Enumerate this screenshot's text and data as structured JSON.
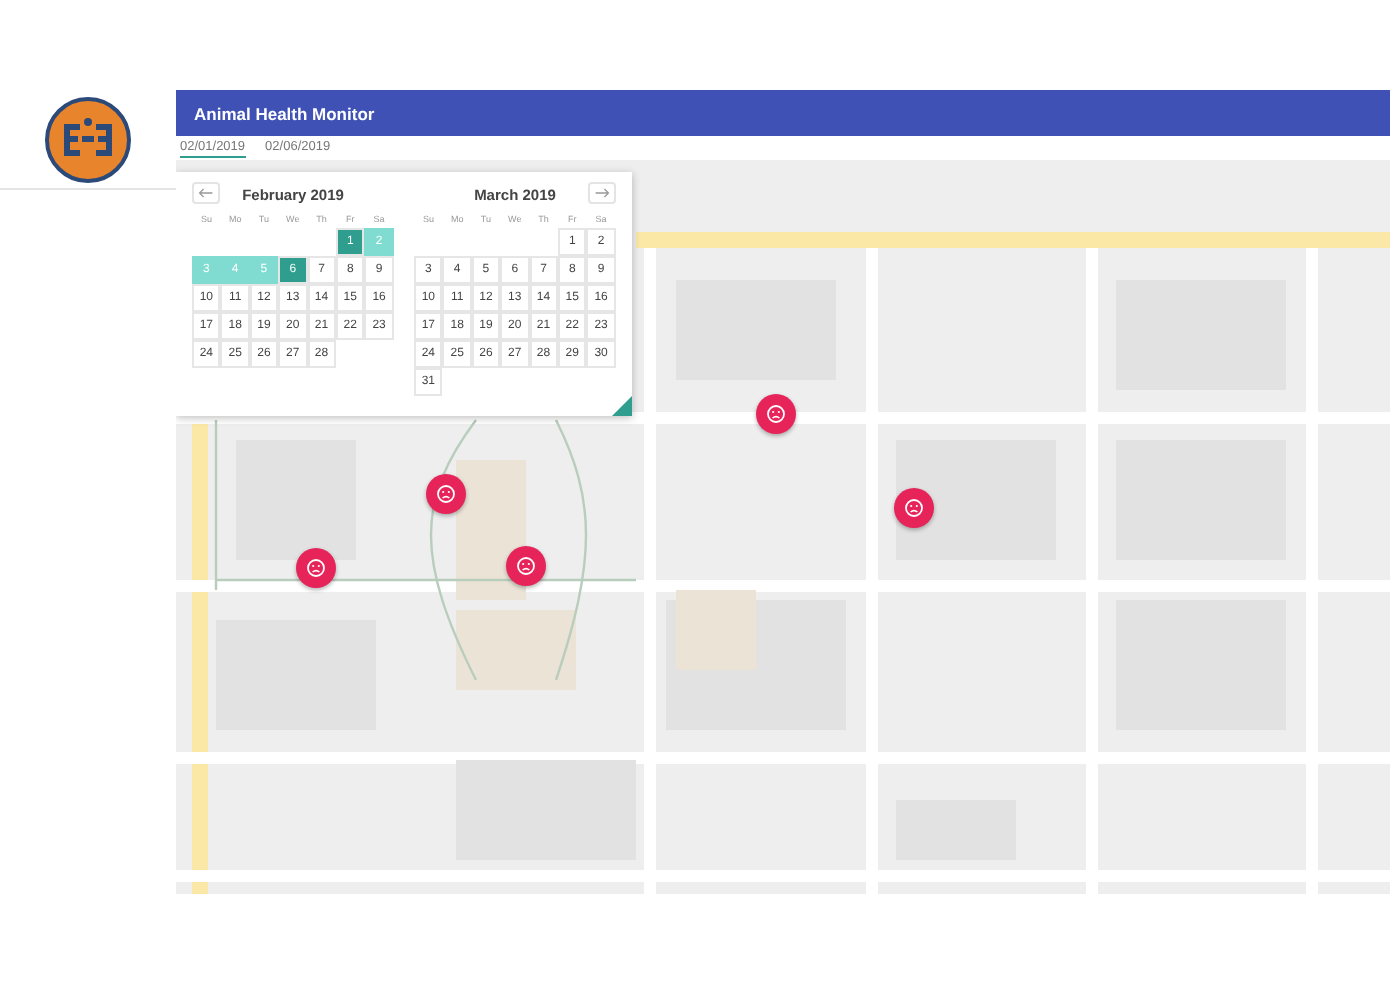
{
  "header": {
    "title": "Animal Health Monitor"
  },
  "date_range": {
    "start": "02/01/2019",
    "end": "02/06/2019"
  },
  "calendar": {
    "months": [
      {
        "title": "February 2019",
        "weekdays": [
          "Su",
          "Mo",
          "Tu",
          "We",
          "Th",
          "Fr",
          "Sa"
        ],
        "weeks": [
          [
            {
              "label": "1",
              "selected": true,
              "in_range": false
            },
            {
              "label": "2",
              "selected": false,
              "in_range": true
            }
          ],
          [
            {
              "label": "3",
              "selected": false,
              "in_range": true
            },
            {
              "label": "4",
              "selected": false,
              "in_range": true
            },
            {
              "label": "5",
              "selected": false,
              "in_range": true
            },
            {
              "label": "6",
              "selected": true,
              "in_range": false
            },
            {
              "label": "7",
              "selected": false,
              "in_range": false
            },
            {
              "label": "8",
              "selected": false,
              "in_range": false
            },
            {
              "label": "9",
              "selected": false,
              "in_range": false
            }
          ],
          [
            {
              "label": "10",
              "selected": false,
              "in_range": false
            },
            {
              "label": "11",
              "selected": false,
              "in_range": false
            },
            {
              "label": "12",
              "selected": false,
              "in_range": false
            },
            {
              "label": "13",
              "selected": false,
              "in_range": false
            },
            {
              "label": "14",
              "selected": false,
              "in_range": false
            },
            {
              "label": "15",
              "selected": false,
              "in_range": false
            },
            {
              "label": "16",
              "selected": false,
              "in_range": false
            }
          ],
          [
            {
              "label": "17",
              "selected": false,
              "in_range": false
            },
            {
              "label": "18",
              "selected": false,
              "in_range": false
            },
            {
              "label": "19",
              "selected": false,
              "in_range": false
            },
            {
              "label": "20",
              "selected": false,
              "in_range": false
            },
            {
              "label": "21",
              "selected": false,
              "in_range": false
            },
            {
              "label": "22",
              "selected": false,
              "in_range": false
            },
            {
              "label": "23",
              "selected": false,
              "in_range": false
            }
          ],
          [
            {
              "label": "24",
              "selected": false,
              "in_range": false
            },
            {
              "label": "25",
              "selected": false,
              "in_range": false
            },
            {
              "label": "26",
              "selected": false,
              "in_range": false
            },
            {
              "label": "27",
              "selected": false,
              "in_range": false
            },
            {
              "label": "28",
              "selected": false,
              "in_range": false
            }
          ]
        ]
      },
      {
        "title": "March 2019",
        "weekdays": [
          "Su",
          "Mo",
          "Tu",
          "We",
          "Th",
          "Fr",
          "Sa"
        ],
        "weeks": [
          [
            {
              "label": "1",
              "selected": false,
              "in_range": false
            },
            {
              "label": "2",
              "selected": false,
              "in_range": false
            }
          ],
          [
            {
              "label": "3",
              "selected": false,
              "in_range": false
            },
            {
              "label": "4",
              "selected": false,
              "in_range": false
            },
            {
              "label": "5",
              "selected": false,
              "in_range": false
            },
            {
              "label": "6",
              "selected": false,
              "in_range": false
            },
            {
              "label": "7",
              "selected": false,
              "in_range": false
            },
            {
              "label": "8",
              "selected": false,
              "in_range": false
            },
            {
              "label": "9",
              "selected": false,
              "in_range": false
            }
          ],
          [
            {
              "label": "10",
              "selected": false,
              "in_range": false
            },
            {
              "label": "11",
              "selected": false,
              "in_range": false
            },
            {
              "label": "12",
              "selected": false,
              "in_range": false
            },
            {
              "label": "13",
              "selected": false,
              "in_range": false
            },
            {
              "label": "14",
              "selected": false,
              "in_range": false
            },
            {
              "label": "15",
              "selected": false,
              "in_range": false
            },
            {
              "label": "16",
              "selected": false,
              "in_range": false
            }
          ],
          [
            {
              "label": "17",
              "selected": false,
              "in_range": false
            },
            {
              "label": "18",
              "selected": false,
              "in_range": false
            },
            {
              "label": "19",
              "selected": false,
              "in_range": false
            },
            {
              "label": "20",
              "selected": false,
              "in_range": false
            },
            {
              "label": "21",
              "selected": false,
              "in_range": false
            },
            {
              "label": "22",
              "selected": false,
              "in_range": false
            },
            {
              "label": "23",
              "selected": false,
              "in_range": false
            }
          ],
          [
            {
              "label": "24",
              "selected": false,
              "in_range": false
            },
            {
              "label": "25",
              "selected": false,
              "in_range": false
            },
            {
              "label": "26",
              "selected": false,
              "in_range": false
            },
            {
              "label": "27",
              "selected": false,
              "in_range": false
            },
            {
              "label": "28",
              "selected": false,
              "in_range": false
            },
            {
              "label": "29",
              "selected": false,
              "in_range": false
            },
            {
              "label": "30",
              "selected": false,
              "in_range": false
            }
          ],
          [
            {
              "label": "31",
              "selected": false,
              "in_range": false
            }
          ]
        ]
      }
    ]
  },
  "map": {
    "markers": [
      {
        "kind": "sad"
      },
      {
        "kind": "sad"
      },
      {
        "kind": "sad"
      },
      {
        "kind": "sad"
      },
      {
        "kind": "sad"
      }
    ]
  }
}
